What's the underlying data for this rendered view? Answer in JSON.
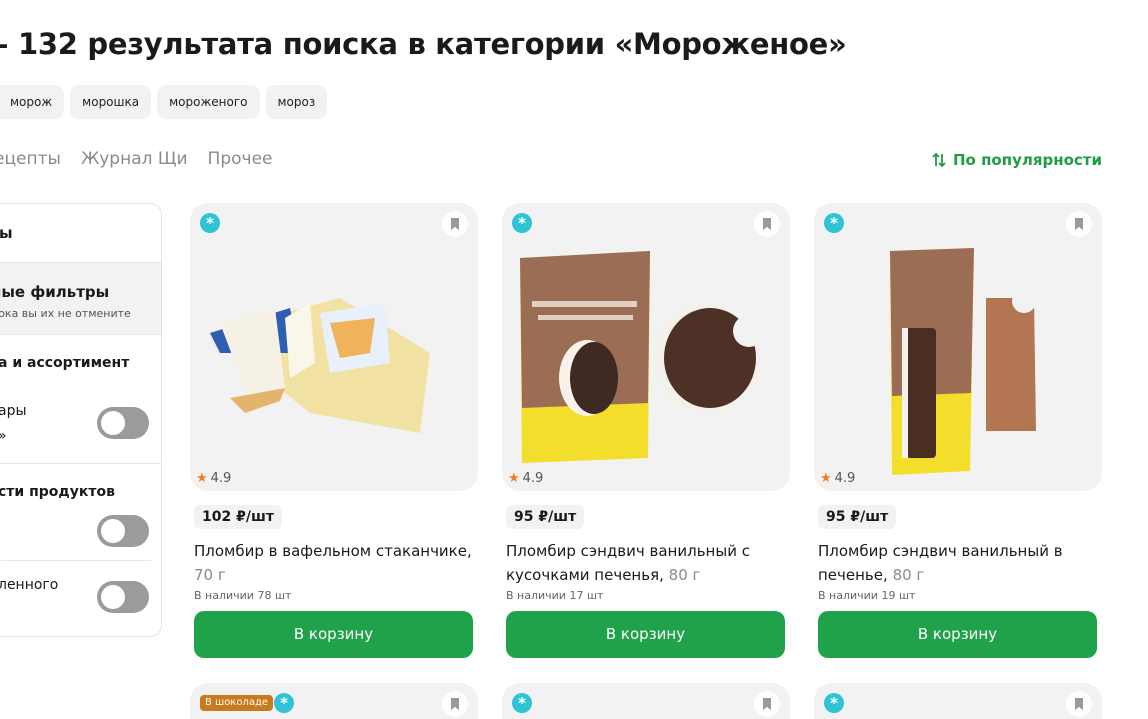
{
  "header": {
    "title": "– 132 результата поиска в категории «Мороженое»"
  },
  "suggestions": [
    "морож",
    "морошка",
    "мороженого",
    "мороз"
  ],
  "tabs": [
    "ецепты",
    "Журнал Щи",
    "Прочее"
  ],
  "sort": {
    "label": "По популярности"
  },
  "filters": {
    "head": "ы",
    "saved_title": "ные фильтры",
    "saved_sub": "пока вы их не отмените",
    "section1": "а и ассортимент",
    "item1_line1": "ары",
    "item1_line2": "»",
    "section2": "сти продуктов",
    "item3": "ленного"
  },
  "products": [
    {
      "rating": "4.9",
      "price": "102 ₽/шт",
      "name": "Пломбир в вафельном стаканчике,",
      "weight": "70 г",
      "stock": "В наличии 78 шт",
      "button": "В корзину"
    },
    {
      "rating": "4.9",
      "price": "95 ₽/шт",
      "name": "Пломбир сэндвич ванильный с кусочками печенья,",
      "weight": "80 г",
      "stock": "В наличии 17 шт",
      "button": "В корзину"
    },
    {
      "rating": "4.9",
      "price": "95 ₽/шт",
      "name": "Пломбир сэндвич ванильный в печенье,",
      "weight": "80 г",
      "stock": "В наличии 19 шт",
      "button": "В корзину"
    }
  ],
  "next_row": {
    "tag": "В шоколаде"
  },
  "colors": {
    "accent": "#20a24b",
    "badge": "#30c3d6",
    "star": "#f07b1f"
  },
  "icons": {
    "badge": "snowflake-badge-icon",
    "bookmark": "bookmark-icon",
    "sort": "sort-arrows-icon",
    "star": "star-icon"
  }
}
